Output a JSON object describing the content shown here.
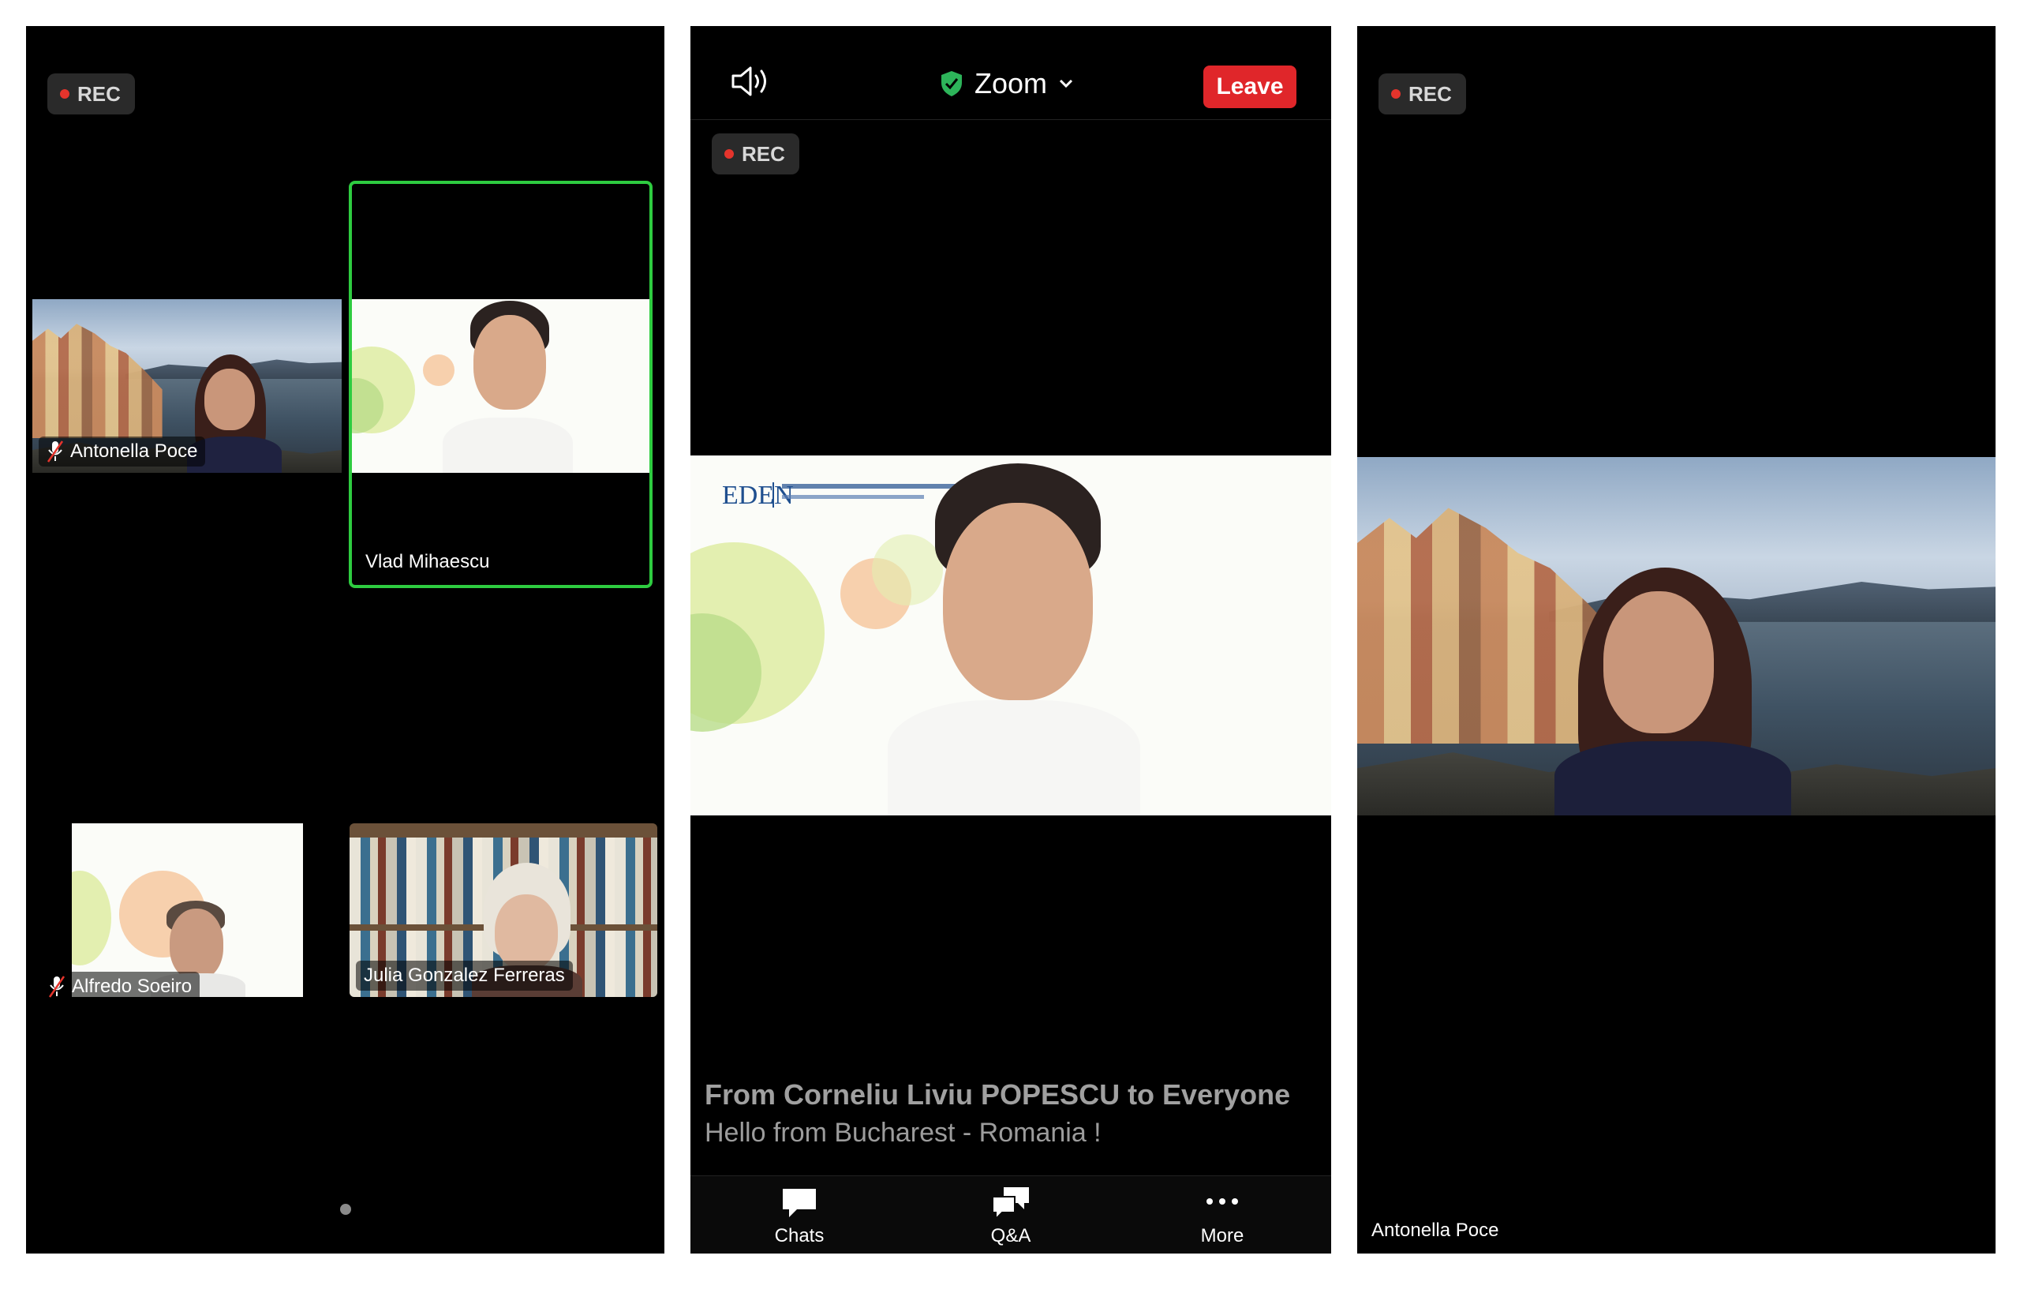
{
  "rec_label": "REC",
  "left_panel": {
    "participants": [
      {
        "name": "Antonella Poce",
        "muted": true
      },
      {
        "name": "Vlad Mihaescu",
        "active_speaker": true
      },
      {
        "name": "Alfredo Soeiro",
        "muted": true
      },
      {
        "name": "Julia Gonzalez Ferreras"
      }
    ],
    "page_indicator": "page 1"
  },
  "center_panel": {
    "app_title": "Zoom",
    "leave_label": "Leave",
    "chat": {
      "from": "From Corneliu Liviu POPESCU to Everyone",
      "message": "Hello from Bucharest - Romania !"
    },
    "bottom_bar": [
      {
        "label": "Chats",
        "icon": "chat-bubble-icon"
      },
      {
        "label": "Q&A",
        "icon": "qa-bubbles-icon"
      },
      {
        "label": "More",
        "icon": "more-dots-icon"
      }
    ]
  },
  "right_panel": {
    "speaker_name": "Antonella Poce"
  },
  "colors": {
    "active_border": "#2ecc40",
    "leave_button": "#e0262a",
    "rec_dot": "#e5342c",
    "shield_green": "#2db45a"
  }
}
